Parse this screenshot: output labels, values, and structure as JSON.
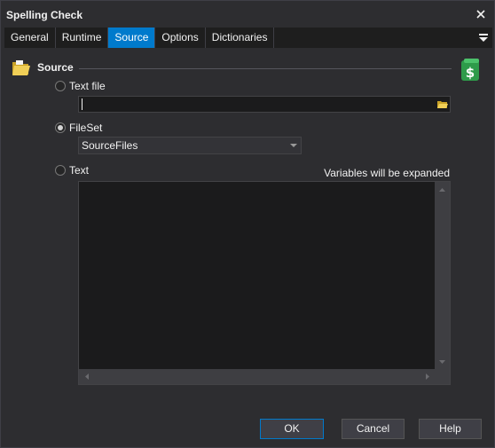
{
  "window": {
    "title": "Spelling Check"
  },
  "tabs": [
    {
      "label": "General"
    },
    {
      "label": "Runtime"
    },
    {
      "label": "Source",
      "active": true
    },
    {
      "label": "Options"
    },
    {
      "label": "Dictionaries"
    }
  ],
  "section": {
    "title": "Source"
  },
  "source": {
    "textfile": {
      "label": "Text file",
      "checked": false,
      "value": ""
    },
    "fileset": {
      "label": "FileSet",
      "checked": true,
      "value": "SourceFiles"
    },
    "text": {
      "label": "Text",
      "checked": false,
      "note": "Variables will be expanded",
      "value": ""
    }
  },
  "buttons": {
    "ok": "OK",
    "cancel": "Cancel",
    "help": "Help"
  },
  "colors": {
    "accent": "#007acc",
    "background": "#2d2d30",
    "field": "#1b1b1c"
  },
  "icons": [
    "close-icon",
    "tab-menu-icon",
    "folder-icon",
    "script-icon",
    "browse-folder-icon",
    "chevron-down-icon"
  ]
}
